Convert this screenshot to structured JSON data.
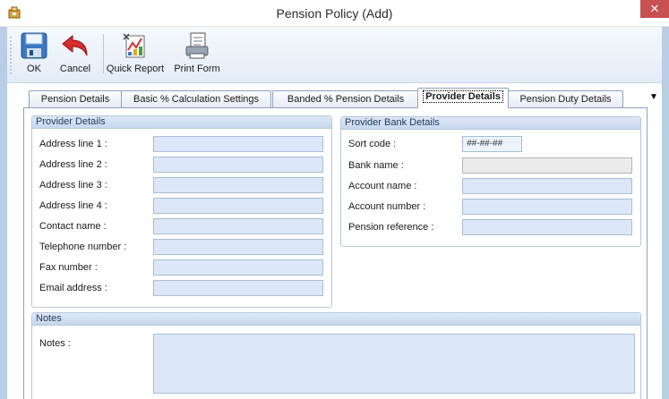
{
  "window": {
    "title": "Pension Policy (Add)",
    "close_glyph": "✕"
  },
  "toolbar": {
    "ok_label": "OK",
    "cancel_label": "Cancel",
    "quick_report_label": "Quick Report",
    "print_form_label": "Print Form"
  },
  "tabs": [
    {
      "label": "Pension Details"
    },
    {
      "label": "Basic % Calculation Settings"
    },
    {
      "label": "Banded % Pension Details"
    },
    {
      "label": "Provider Details"
    },
    {
      "label": "Pension Duty Details"
    }
  ],
  "tab_more_glyph": "▼",
  "provider_details": {
    "heading": "Provider Details",
    "rows": [
      {
        "label": "Address line 1 :",
        "value": ""
      },
      {
        "label": "Address line 2 :",
        "value": ""
      },
      {
        "label": "Address line 3 :",
        "value": ""
      },
      {
        "label": "Address line 4 :",
        "value": ""
      },
      {
        "label": "Contact name :",
        "value": ""
      },
      {
        "label": "Telephone number :",
        "value": ""
      },
      {
        "label": "Fax number :",
        "value": ""
      },
      {
        "label": "Email address :",
        "value": ""
      }
    ]
  },
  "bank_details": {
    "heading": "Provider Bank Details",
    "sort_code_label": "Sort code :",
    "sort_code_mask": "##-##-##",
    "bank_name_label": "Bank name :",
    "account_name_label": "Account name :",
    "account_number_label": "Account number :",
    "pension_reference_label": "Pension reference :"
  },
  "notes": {
    "heading": "Notes",
    "label": "Notes :",
    "value": ""
  },
  "colors": {
    "accent": "#1e395b",
    "field_bg": "#dce8f7",
    "close_button": "#c75050"
  }
}
